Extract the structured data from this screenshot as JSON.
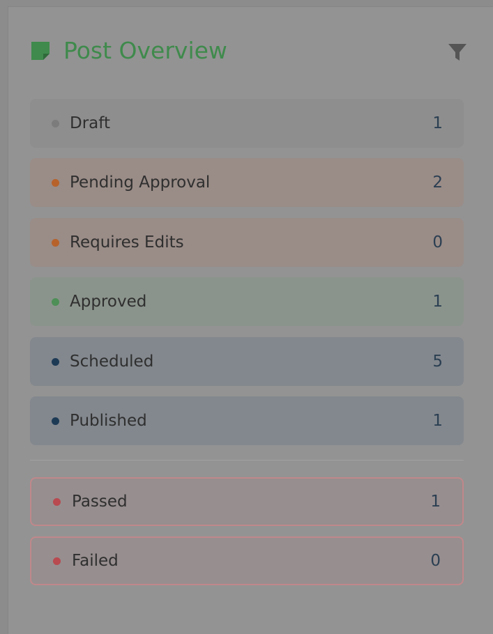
{
  "header": {
    "title": "Post Overview",
    "title_icon": "note-icon",
    "filter_icon": "filter-icon"
  },
  "statuses": [
    {
      "label": "Draft",
      "count": "1",
      "dot_color": "#7c7c7c",
      "bg": "#8e8e8e"
    },
    {
      "label": "Pending Approval",
      "count": "2",
      "dot_color": "#b7622b",
      "bg": "#9a8c87"
    },
    {
      "label": "Requires Edits",
      "count": "0",
      "dot_color": "#b7622b",
      "bg": "#9a8c87"
    },
    {
      "label": "Approved",
      "count": "1",
      "dot_color": "#4e8f57",
      "bg": "#8b948c"
    },
    {
      "label": "Scheduled",
      "count": "5",
      "dot_color": "#1d3a55",
      "bg": "#83888e"
    },
    {
      "label": "Published",
      "count": "1",
      "dot_color": "#1d3a55",
      "bg": "#83888e"
    }
  ],
  "checks": [
    {
      "label": "Passed",
      "count": "1",
      "dot_color": "#b84a50",
      "bg": "#978e8f"
    },
    {
      "label": "Failed",
      "count": "0",
      "dot_color": "#b84a50",
      "bg": "#978e8f"
    }
  ]
}
